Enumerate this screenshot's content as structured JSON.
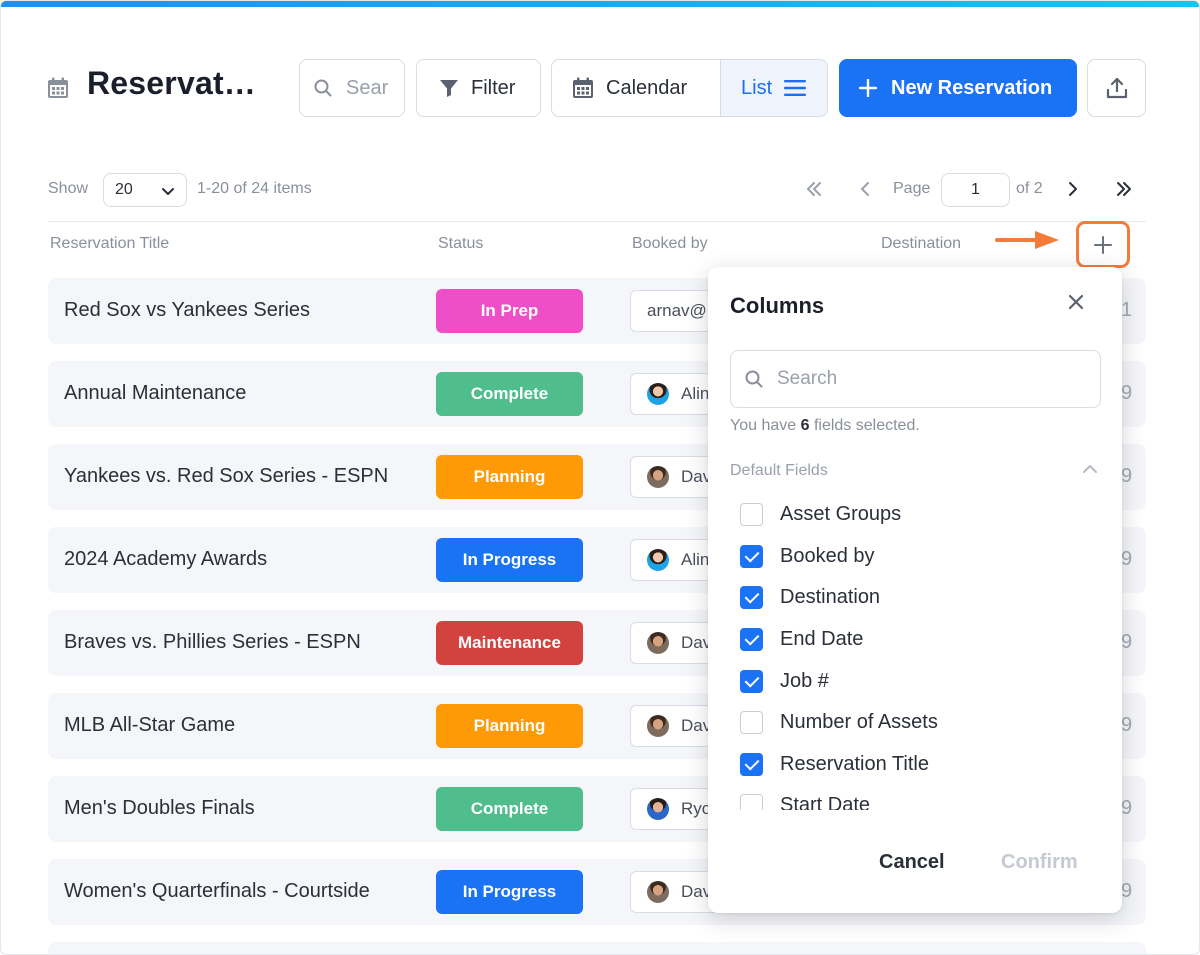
{
  "header": {
    "title": "Reservat…",
    "search_placeholder": "Sear",
    "filter_label": "Filter",
    "calendar_label": "Calendar",
    "list_label": "List",
    "new_label": "New Reservation"
  },
  "pagination": {
    "show_label": "Show",
    "page_size": "20",
    "items_label": "1-20 of 24 items",
    "page_label": "Page",
    "page_value": "1",
    "of_label": "of 2"
  },
  "table": {
    "columns": [
      "Reservation Title",
      "Status",
      "Booked by",
      "Destination"
    ],
    "rows": [
      {
        "title": "Red Sox vs Yankees Series",
        "status": "In Prep",
        "status_color": "#ee4fc7",
        "booked": "arnav@",
        "avatar": "none",
        "trail": "1"
      },
      {
        "title": "Annual Maintenance",
        "status": "Complete",
        "status_color": "#4fbd8c",
        "booked": "Alin",
        "avatar": "female",
        "trail": "9"
      },
      {
        "title": "Yankees vs. Red Sox Series - ESPN",
        "status": "Planning",
        "status_color": "#fd9a05",
        "booked": "Dav",
        "avatar": "male",
        "trail": "9"
      },
      {
        "title": "2024 Academy Awards",
        "status": "In Progress",
        "status_color": "#1a73f5",
        "booked": "Alin",
        "avatar": "female",
        "trail": "9"
      },
      {
        "title": "Braves vs. Phillies Series - ESPN",
        "status": "Maintenance",
        "status_color": "#d2423f",
        "booked": "Dav",
        "avatar": "male",
        "trail": "9"
      },
      {
        "title": "MLB All-Star Game",
        "status": "Planning",
        "status_color": "#fd9a05",
        "booked": "Dav",
        "avatar": "male",
        "trail": "9"
      },
      {
        "title": "Men's Doubles Finals",
        "status": "Complete",
        "status_color": "#4fbd8c",
        "booked": "Ryo",
        "avatar": "male2",
        "trail": "9"
      },
      {
        "title": "Women's Quarterfinals - Courtside",
        "status": "In Progress",
        "status_color": "#1a73f5",
        "booked": "Dav",
        "avatar": "male",
        "trail": "9"
      }
    ]
  },
  "columns_popover": {
    "title": "Columns",
    "search_placeholder": "Search",
    "count_prefix": "You have",
    "count_value": "6",
    "count_suffix": "fields selected.",
    "section_label": "Default Fields",
    "fields": [
      {
        "label": "Asset Groups",
        "checked": false
      },
      {
        "label": "Booked by",
        "checked": true
      },
      {
        "label": "Destination",
        "checked": true
      },
      {
        "label": "End Date",
        "checked": true
      },
      {
        "label": "Job #",
        "checked": true
      },
      {
        "label": "Number of Assets",
        "checked": false
      },
      {
        "label": "Reservation Title",
        "checked": true
      },
      {
        "label": "Start Date",
        "checked": false
      }
    ],
    "cancel_label": "Cancel",
    "confirm_label": "Confirm"
  },
  "colors": {
    "accent": "#1a73f5",
    "highlight": "#f47b3a"
  }
}
